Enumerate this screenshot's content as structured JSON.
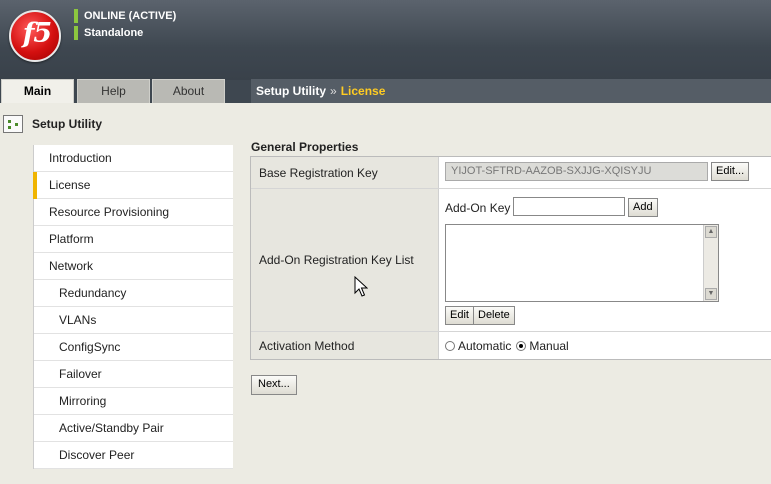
{
  "header": {
    "logo_text": "f5",
    "status_online": "ONLINE (ACTIVE)",
    "status_mode": "Standalone"
  },
  "tabs": [
    {
      "label": "Main",
      "active": true
    },
    {
      "label": "Help",
      "active": false
    },
    {
      "label": "About",
      "active": false
    }
  ],
  "breadcrumb": {
    "parent": "Setup Utility",
    "separator": "»",
    "current": "License"
  },
  "sidebar": {
    "title": "Setup Utility",
    "items": [
      {
        "label": "Introduction"
      },
      {
        "label": "License"
      },
      {
        "label": "Resource Provisioning"
      },
      {
        "label": "Platform"
      },
      {
        "label": "Network"
      },
      {
        "label": "Redundancy"
      },
      {
        "label": "VLANs"
      },
      {
        "label": "ConfigSync"
      },
      {
        "label": "Failover"
      },
      {
        "label": "Mirroring"
      },
      {
        "label": "Active/Standby Pair"
      },
      {
        "label": "Discover Peer"
      }
    ]
  },
  "general": {
    "title": "General Properties",
    "base_key_label": "Base Registration Key",
    "base_key_value": "YIJOT-SFTRD-AAZOB-SXJJG-XQISYJU",
    "edit_button": "Edit...",
    "addon_list_label": "Add-On Registration Key List",
    "addon_key_label": "Add-On Key",
    "add_button": "Add",
    "list_edit_button": "Edit",
    "delete_button": "Delete",
    "activation_label": "Activation Method",
    "automatic_label": "Automatic",
    "manual_label": "Manual",
    "selected_method": "Manual"
  },
  "next_button": "Next...",
  "colors": {
    "status_bar": "#8cc63f",
    "crumb_current": "#ffcc22",
    "active_nav_marker": "#f0b400"
  }
}
